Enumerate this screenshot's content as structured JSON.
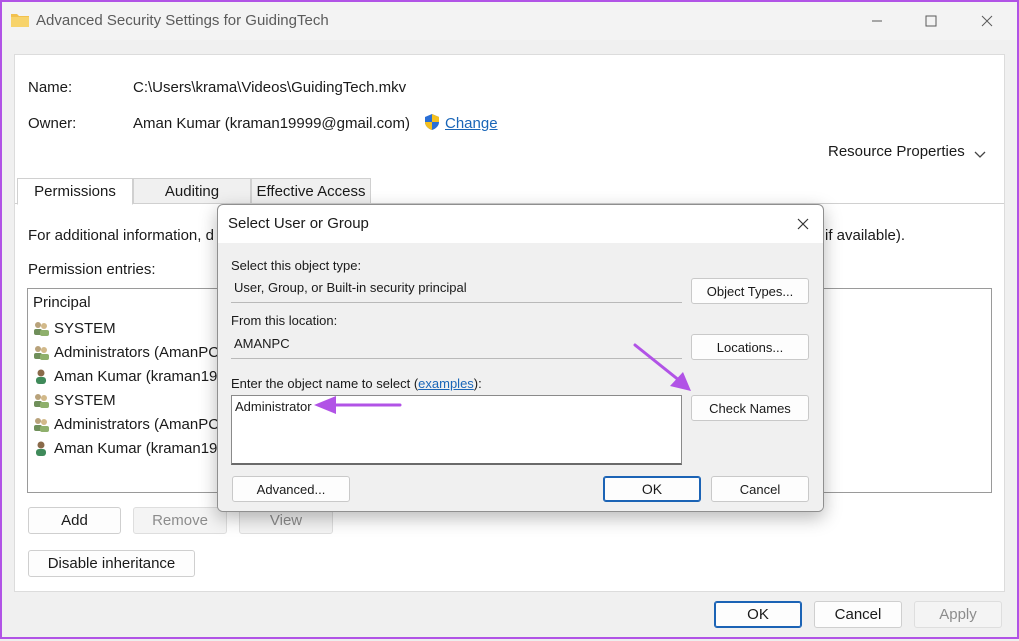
{
  "window": {
    "title": "Advanced Security Settings for GuidingTech",
    "icon": "folder-icon"
  },
  "file": {
    "name_label": "Name:",
    "name_value": "C:\\Users\\krama\\Videos\\GuidingTech.mkv",
    "owner_label": "Owner:",
    "owner_value": "Aman Kumar (kraman19999@gmail.com)",
    "change_link": "Change"
  },
  "resource_properties": "Resource Properties",
  "tabs": [
    {
      "label": "Permissions",
      "active": true
    },
    {
      "label": "Auditing",
      "active": false
    },
    {
      "label": "Effective Access",
      "active": false
    }
  ],
  "info_left": "For additional information, d",
  "info_right": "if available).",
  "permission_entries_label": "Permission entries:",
  "principal_header": "Principal",
  "entries": [
    {
      "name": "SYSTEM",
      "icon": "group-icon"
    },
    {
      "name": "Administrators (AmanPC",
      "icon": "group-icon"
    },
    {
      "name": "Aman Kumar (kraman199",
      "icon": "user-icon"
    },
    {
      "name": "SYSTEM",
      "icon": "group-icon"
    },
    {
      "name": "Administrators (AmanPC",
      "icon": "group-icon"
    },
    {
      "name": "Aman Kumar (kraman199",
      "icon": "user-icon"
    }
  ],
  "entry_buttons": {
    "add": "Add",
    "remove": "Remove",
    "view": "View",
    "disable_inheritance": "Disable inheritance"
  },
  "footer": {
    "ok": "OK",
    "cancel": "Cancel",
    "apply": "Apply"
  },
  "dialog": {
    "title": "Select User or Group",
    "object_type_label": "Select this object type:",
    "object_type_value": "User, Group, or Built-in security principal",
    "object_types_button": "Object Types...",
    "location_label": "From this location:",
    "location_value": "AMANPC",
    "locations_button": "Locations...",
    "enter_name_prefix": "Enter the object name to select (",
    "examples_link": "examples",
    "enter_name_suffix": "):",
    "object_name_value": "Administrator",
    "check_names_button": "Check Names",
    "advanced_button": "Advanced...",
    "ok": "OK",
    "cancel": "Cancel"
  },
  "colors": {
    "highlight_arrow": "#b153e6",
    "primary_border": "#1b63b5",
    "link": "#1a66b8"
  }
}
